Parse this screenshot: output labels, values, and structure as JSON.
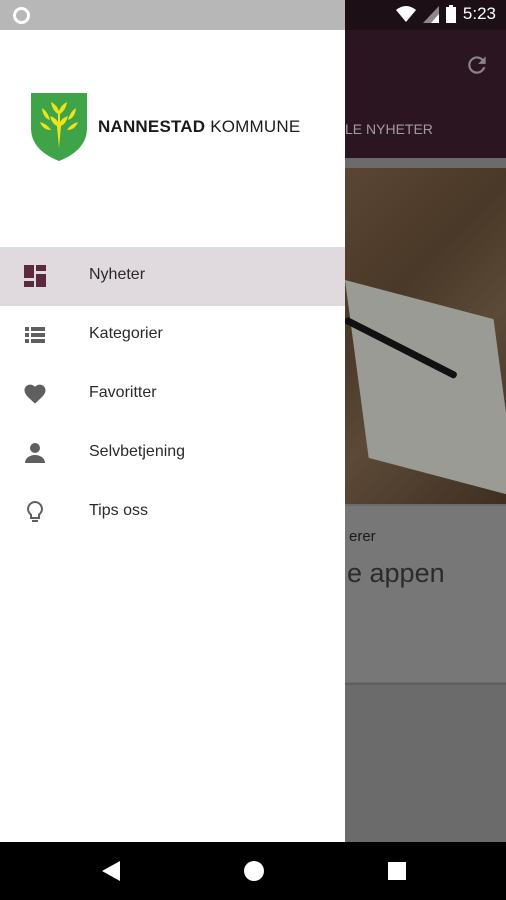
{
  "status_bar": {
    "time": "5:23",
    "icons": [
      "circle-notification-icon",
      "wifi-icon",
      "signal-icon",
      "battery-icon"
    ]
  },
  "drawer": {
    "logo": {
      "name_bold": "NANNESTAD",
      "name_regular": "KOMMUNE",
      "icon": "coat-of-arms-icon"
    },
    "items": [
      {
        "label": "Nyheter",
        "icon": "dashboard-icon",
        "active": true
      },
      {
        "label": "Kategorier",
        "icon": "list-icon",
        "active": false
      },
      {
        "label": "Favoritter",
        "icon": "heart-icon",
        "active": false
      },
      {
        "label": "Selvbetjening",
        "icon": "person-icon",
        "active": false
      },
      {
        "label": "Tips oss",
        "icon": "lightbulb-icon",
        "active": false
      }
    ]
  },
  "background_app": {
    "tab_label": "LE NYHETER",
    "card_category": "erer",
    "card_title": "e appen",
    "icons": [
      "refresh-icon"
    ]
  },
  "nav_bar": {
    "icons": [
      "back-icon",
      "home-icon",
      "recents-icon"
    ]
  },
  "colors": {
    "accent": "#5c2a3e",
    "active_bg": "#e0d9dd",
    "appbar": "#2a1520"
  }
}
